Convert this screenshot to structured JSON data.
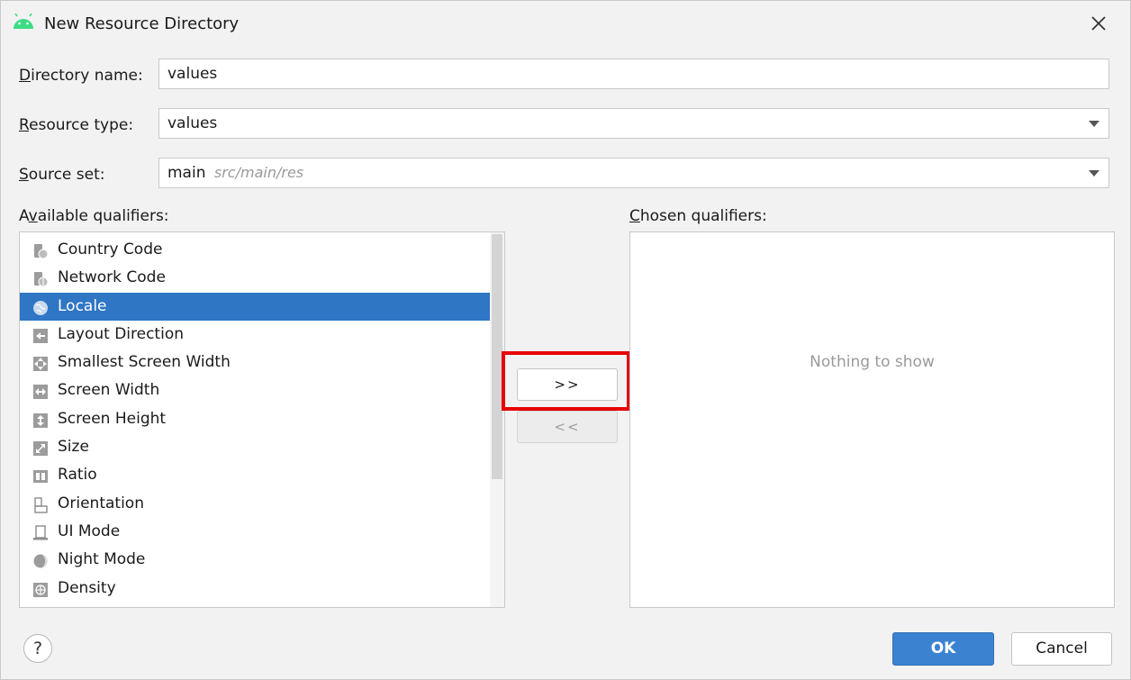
{
  "window": {
    "title": "New Resource Directory",
    "app_icon": "android-icon",
    "close_icon": "close-icon"
  },
  "form": {
    "directory_name": {
      "mnemonic": "D",
      "rest": "irectory name:",
      "value": "values"
    },
    "resource_type": {
      "mnemonic": "R",
      "rest": "esource type:",
      "value": "values"
    },
    "source_set": {
      "mnemonic": "S",
      "rest": "ource set:",
      "value": "main",
      "hint": "src/main/res"
    }
  },
  "available": {
    "label_pre": "A",
    "label_mn": "v",
    "label_rest": "ailable qualifiers:",
    "items": [
      {
        "label": "Country Code",
        "icon": "country-code-icon"
      },
      {
        "label": "Network Code",
        "icon": "network-code-icon"
      },
      {
        "label": "Locale",
        "icon": "globe-icon",
        "selected": true
      },
      {
        "label": "Layout Direction",
        "icon": "layout-direction-icon"
      },
      {
        "label": "Smallest Screen Width",
        "icon": "smallest-screen-width-icon"
      },
      {
        "label": "Screen Width",
        "icon": "screen-width-icon"
      },
      {
        "label": "Screen Height",
        "icon": "screen-height-icon"
      },
      {
        "label": "Size",
        "icon": "size-icon"
      },
      {
        "label": "Ratio",
        "icon": "ratio-icon"
      },
      {
        "label": "Orientation",
        "icon": "orientation-icon"
      },
      {
        "label": "UI Mode",
        "icon": "ui-mode-icon"
      },
      {
        "label": "Night Mode",
        "icon": "night-mode-icon"
      },
      {
        "label": "Density",
        "icon": "density-icon"
      }
    ]
  },
  "chosen": {
    "label_mn": "C",
    "label_rest": "hosen qualifiers:",
    "empty_text": "Nothing to show"
  },
  "buttons": {
    "add": ">>",
    "remove": "<<",
    "help": "?",
    "ok": "OK",
    "cancel": "Cancel"
  },
  "colors": {
    "selection": "#2f76c4",
    "ok_button": "#3b83d1",
    "highlight": "#e60000",
    "android_green": "#3ddc84"
  }
}
